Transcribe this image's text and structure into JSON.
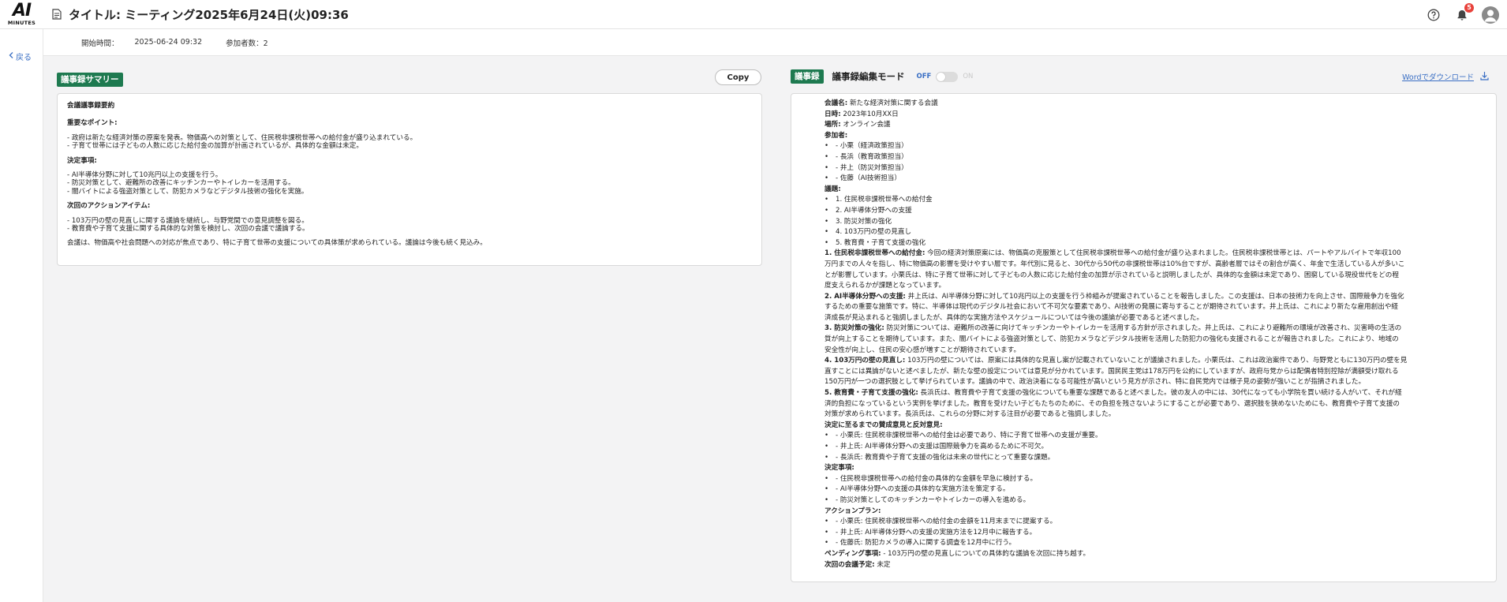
{
  "header": {
    "logo_top": "AI",
    "logo_bottom": "MINUTES",
    "title": "タイトル:  ミーティング2025年6月24日(火)09:36",
    "notification_count": "5"
  },
  "nav": {
    "back_label": "戻る"
  },
  "meta": {
    "start_label": "開始時間：",
    "start_value": "2025-06-24 09:32",
    "participants": "参加者数：2"
  },
  "summary": {
    "tag": "議事録サマリー",
    "copy_label": "Copy",
    "heading": "会議議事録要約",
    "points_heading": "重要なポイント:",
    "points": [
      "- 政府は新たな経済対策の原案を発表。物価高への対策として、住民税非課税世帯への給付金が盛り込まれている。",
      "- 子育て世帯には子どもの人数に応じた給付金の加算が計画されているが、具体的な金額は未定。"
    ],
    "decisions_heading": "決定事項:",
    "decisions": [
      "- AI半導体分野に対して10兆円以上の支援を行う。",
      "- 防災対策として、避難所の改善にキッチンカーやトイレカーを活用する。",
      "- 闇バイトによる強盗対策として、防犯カメラなどデジタル技術の強化を実施。"
    ],
    "actions_heading": "次回のアクションアイテム:",
    "actions": [
      "- 103万円の壁の見直しに関する議論を継続し、与野党間での意見調整を図る。",
      "- 教育費や子育て支援に関する具体的な対策を検討し、次回の会議で議論する。"
    ],
    "conclusion": "会議は、物価高や社会問題への対応が焦点であり、特に子育て世帯の支援についての具体策が求められている。議論は今後も続く見込み。"
  },
  "minutes": {
    "tag": "議事録",
    "edit_mode_label": "議事録編集モード",
    "toggle_off": "OFF",
    "toggle_on": "ON",
    "download_label": "Wordでダウンロード",
    "meeting_name_label": "会議名:",
    "meeting_name": " 新たな経済対策に関する会議",
    "date_label": "日時:",
    "date": " 2023年10月XX日",
    "place_label": "場所:",
    "place": " オンライン会議",
    "attendees_label": "参加者:",
    "attendees": [
      "- 小栗（経済政策担当）",
      "- 長浜（教育政策担当）",
      "- 井上（防災対策担当）",
      "- 佐藤（AI技術担当）"
    ],
    "agenda_label": "議題:",
    "agenda": [
      "1. 住民税非課税世帯への給付金",
      "2. AI半導体分野への支援",
      "3. 防災対策の強化",
      "4. 103万円の壁の見直し",
      "5. 教育費・子育て支援の強化"
    ],
    "sections": [
      {
        "title": "1. 住民税非課税世帯への給付金:",
        "lines": [
          " 今回の経済対策原案には、物価高の克服策として住民税非課税世帯への給付金が盛り込まれました。住民税非課税世帯とは、パートやアルバイトで年収100",
          "万円までの人々を指し、特に物価高の影響を受けやすい層です。年代別に見ると、30代から50代の非課税世帯は10%台ですが、高齢者層ではその割合が高く、年金で生活している人が多いこ",
          "とが影響しています。小栗氏は、特に子育て世帯に対して子どもの人数に応じた給付金の加算が示されていると説明しましたが、具体的な金額は未定であり、困窮している現役世代をどの程",
          "度支えられるかが課題となっています。"
        ]
      },
      {
        "title": "2. AI半導体分野への支援:",
        "lines": [
          " 井上氏は、AI半導体分野に対して10兆円以上の支援を行う枠組みが提案されていることを報告しました。この支援は、日本の技術力を向上させ、国際競争力を強化",
          "するための重要な施策です。特に、半導体は現代のデジタル社会において不可欠な要素であり、AI技術の発展に寄与することが期待されています。井上氏は、これにより新たな雇用創出や経",
          "済成長が見込まれると強調しましたが、具体的な実施方法やスケジュールについては今後の議論が必要であると述べました。"
        ]
      },
      {
        "title": "3. 防災対策の強化:",
        "lines": [
          " 防災対策については、避難所の改善に向けてキッチンカーやトイレカーを活用する方針が示されました。井上氏は、これにより避難所の環境が改善され、災害時の生活の",
          "質が向上することを期待しています。また、闇バイトによる強盗対策として、防犯カメラなどデジタル技術を活用した防犯力の強化も支援されることが報告されました。これにより、地域の",
          "安全性が向上し、住民の安心感が増すことが期待されています。"
        ]
      },
      {
        "title": "4. 103万円の壁の見直し:",
        "lines": [
          " 103万円の壁については、原案には具体的な見直し案が記載されていないことが議論されました。小栗氏は、これは政治案件であり、与野党ともに130万円の壁を見",
          "直すことには異論がないと述べましたが、新たな壁の設定については意見が分かれています。国民民主党は178万円を公約にしていますが、政府与党からは配偶者特別控除が満額受け取れる",
          "150万円が一つの選択肢として挙げられています。議論の中で、政治決着になる可能性が高いという見方が示され、特に自民党内では様子見の姿勢が強いことが指摘されました。"
        ]
      },
      {
        "title": "5. 教育費・子育て支援の強化:",
        "lines": [
          " 長浜氏は、教育費や子育て支援の強化についても重要な課題であると述べました。彼の友人の中には、30代になっても小学院を買い続ける人がいて、それが経",
          "済的負担になっているという実例を挙げました。教育を受けたい子どもたちのために、その負担を残さないようにすることが必要であり、選択肢を狭めないためにも、教育費や子育て支援の",
          "対策が求められています。長浜氏は、これらの分野に対する注目が必要であると強調しました。"
        ]
      }
    ],
    "opinions_label": "決定に至るまでの賛成意見と反対意見:",
    "opinions": [
      "- 小栗氏: 住民税非課税世帯への給付金は必要であり、特に子育て世帯への支援が重要。",
      "- 井上氏: AI半導体分野への支援は国際競争力を高めるために不可欠。",
      "- 長浜氏: 教育費や子育て支援の強化は未来の世代にとって重要な課題。"
    ],
    "decisions_label": "決定事項:",
    "decisions": [
      "- 住民税非課税世帯への給付金の具体的な金額を早急に検討する。",
      "- AI半導体分野への支援の具体的な実施方法を策定する。",
      "- 防災対策としてのキッチンカーやトイレカーの導入を進める。"
    ],
    "plan_label": "アクションプラン:",
    "plan": [
      "- 小栗氏: 住民税非課税世帯への給付金の金額を11月末までに提案する。",
      "- 井上氏: AI半導体分野への支援の実施方法を12月中に報告する。",
      "- 佐藤氏: 防犯カメラの導入に関する調査を12月中に行う。"
    ],
    "pending_label": "ペンディング事項:",
    "pending": " - 103万円の壁の見直しについての具体的な議論を次回に持ち越す。",
    "next_label": "次回の会議予定:",
    "next": " 未定"
  }
}
